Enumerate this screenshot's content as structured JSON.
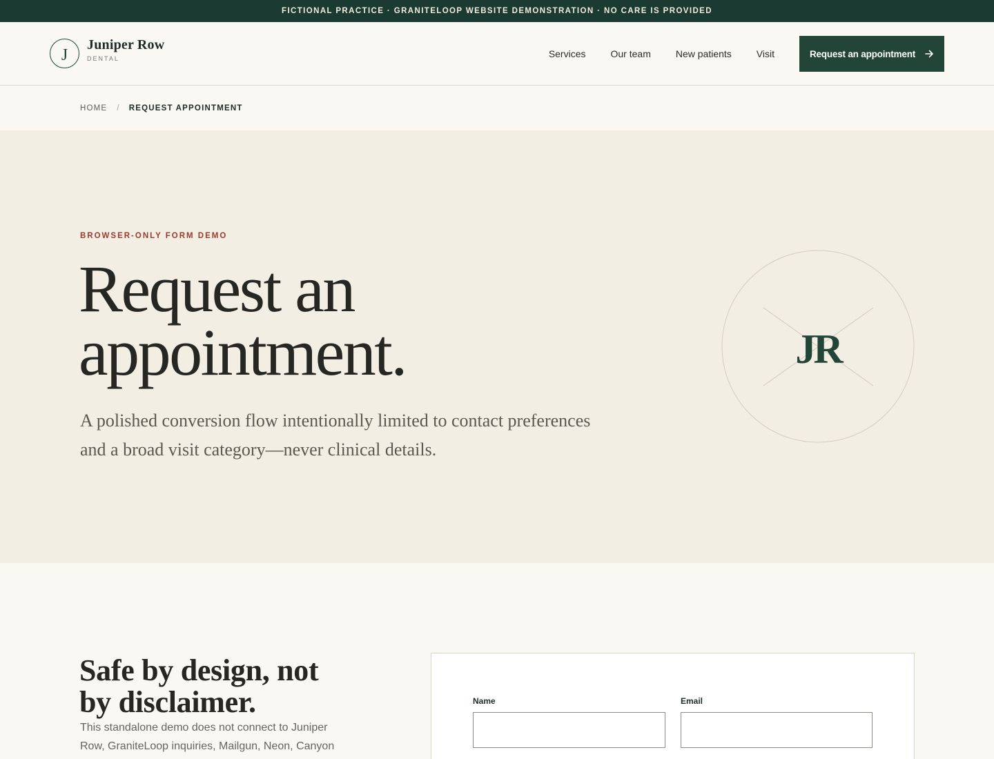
{
  "topbar": {
    "text": "FICTIONAL PRACTICE · GRANITELOOP WEBSITE DEMONSTRATION · NO CARE IS PROVIDED"
  },
  "logo": {
    "mark": "J",
    "name": "Juniper Row",
    "sub": "DENTAL"
  },
  "nav": {
    "items": [
      {
        "label": "Services"
      },
      {
        "label": "Our team"
      },
      {
        "label": "New patients"
      },
      {
        "label": "Visit"
      }
    ],
    "cta_label": "Request an appointment",
    "cta_icon": "arrow-right-icon"
  },
  "breadcrumb": {
    "home": "HOME",
    "separator": "/",
    "current": "REQUEST APPOINTMENT"
  },
  "hero": {
    "eyebrow": "BROWSER-ONLY FORM DEMO",
    "title": "Request an appointment.",
    "subtitle": "A polished conversion flow intentionally limited to contact preferences and a broad visit category—never clinical details.",
    "seal_text": "JR"
  },
  "section": {
    "title": "Safe by design, not by disclaimer.",
    "body": "This standalone demo does not connect to Juniper Row, GraniteLoop inquiries, Mailgun, Neon, Canyon State Lofts, or any other service."
  },
  "form": {
    "name_label": "Name",
    "name_value": "",
    "email_label": "Email",
    "email_value": ""
  },
  "colors": {
    "brand_dark": "#1b3a31",
    "cta": "#224538",
    "accent": "#9a3b2c",
    "hero_bg": "#f2eee3",
    "page_bg": "#faf8f3"
  }
}
